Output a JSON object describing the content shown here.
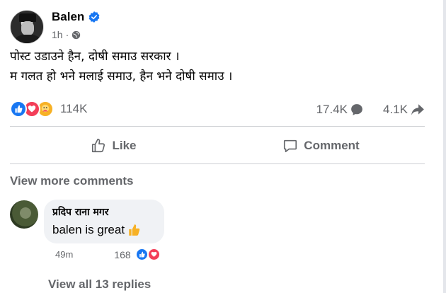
{
  "post": {
    "author_name": "Balen",
    "time": "1h",
    "dot": "·",
    "text_line1": "पोस्ट उडाउने हैन, दोषी समाउ सरकार ।",
    "text_line2": "म गलत हो भने मलाई समाउ, हैन भने दोषी समाउ ।",
    "reactions_count": "114K",
    "comments_count": "17.4K",
    "shares_count": "4.1K",
    "icons": [
      "verified-badge-icon",
      "globe-icon",
      "like-reaction-icon",
      "love-reaction-icon",
      "care-reaction-icon",
      "comment-bubble-icon",
      "share-arrow-icon"
    ]
  },
  "actions": {
    "like_label": "Like",
    "comment_label": "Comment"
  },
  "comments": {
    "view_more_label": "View more comments",
    "items": [
      {
        "author": "प्रदिप राना मगर",
        "text": "balen is great",
        "time": "49m",
        "reaction_count": "168"
      }
    ],
    "view_replies_label": "View all 13 replies"
  },
  "colors": {
    "accent": "#1877f2",
    "love": "#f33e58",
    "care": "#f7b125",
    "secondary_text": "#65676b",
    "bubble": "#f0f2f5"
  }
}
